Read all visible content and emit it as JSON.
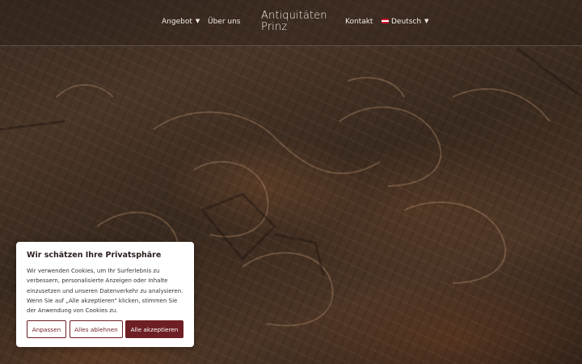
{
  "nav": {
    "items": [
      {
        "label": "Angebot",
        "has_dropdown": true,
        "icon": "chevron-down-icon"
      },
      {
        "label": "Über uns",
        "has_dropdown": false
      },
      {
        "label": "Kontakt",
        "has_dropdown": false
      },
      {
        "label": "Deutsch",
        "has_dropdown": true,
        "icon": "chevron-down-icon",
        "flag": "austria-flag-icon"
      }
    ],
    "logo_line1": "Antiquitäten",
    "logo_line2": "Prinz"
  },
  "cookie_banner": {
    "title": "Wir schätzen Ihre Privatsphäre",
    "text": "Wir verwenden Cookies, um Ihr Surferlebnis zu verbessern, personalisierte Anzeigen oder Inhalte einzusetzen und unseren Datenverkehr zu analysieren. Wenn Sie auf „Alle akzeptieren\" klicken, stimmen Sie der Anwendung von Cookies zu.",
    "buttons": {
      "customize": "Anpassen",
      "reject": "Alles ablehnen",
      "accept": "Alle akzeptieren"
    },
    "accent_color": "#6e1f23"
  },
  "hero": {
    "image_subject": "carved-dark-wood"
  }
}
